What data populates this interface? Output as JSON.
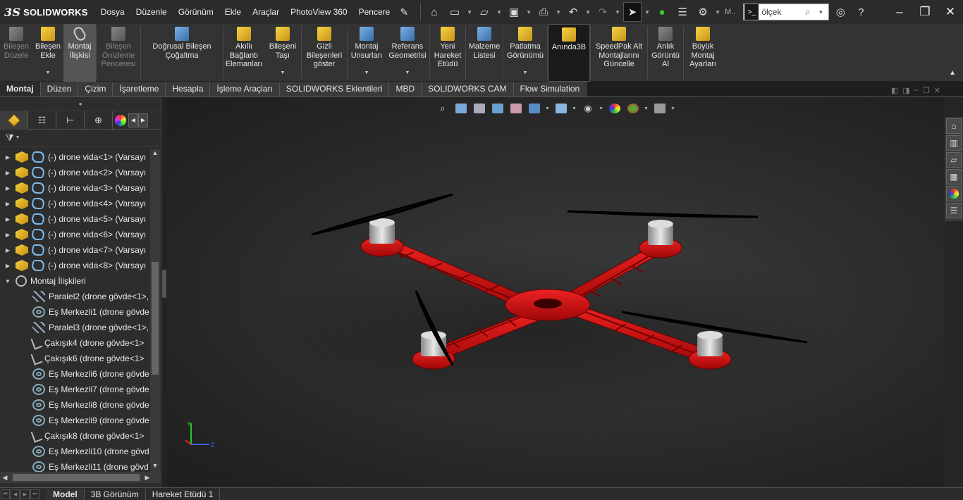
{
  "app": {
    "brand": "SOLIDWORKS"
  },
  "menus": [
    "Dosya",
    "Düzenle",
    "Görünüm",
    "Ekle",
    "Araçlar",
    "PhotoView 360",
    "Pencere"
  ],
  "search": {
    "value": "ölçek",
    "more_label": "M.."
  },
  "ribbon": [
    {
      "label": "Bileşen Düzele",
      "disabled": true,
      "icon": "edit-component-icon"
    },
    {
      "label": "Bileşen Ekle",
      "icon": "insert-component-icon"
    },
    {
      "label": "Montaj İlişkisi",
      "active": true,
      "icon": "mate-icon"
    },
    {
      "label": "Bileşen Önizleme Penceresi",
      "disabled": true,
      "icon": "component-preview-icon"
    },
    {
      "label": "Doğrusal Bileşen Çoğaltma",
      "icon": "linear-pattern-icon"
    },
    {
      "label": "Akıllı Bağlantı Elemanları",
      "icon": "smart-fasteners-icon"
    },
    {
      "label": "Bileşeni Taşı",
      "icon": "move-component-icon"
    },
    {
      "label": "Gizli Bileşenleri göster",
      "icon": "show-hidden-icon"
    },
    {
      "label": "Montaj Unsurları",
      "icon": "assembly-features-icon"
    },
    {
      "label": "Referans Geometrisi",
      "icon": "reference-geometry-icon"
    },
    {
      "label": "Yeni Hareket Etüdü",
      "icon": "new-motion-study-icon"
    },
    {
      "label": "Malzeme Listesi",
      "icon": "bom-icon"
    },
    {
      "label": "Patlatma Görünümü",
      "icon": "exploded-view-icon"
    },
    {
      "label": "Anında3B",
      "boxed": true,
      "icon": "instant3d-icon"
    },
    {
      "label": "SpeedPak Alt Montajlarını Güncelle",
      "icon": "speedpak-icon"
    },
    {
      "label": "Anlık Görüntü Al",
      "icon": "snapshot-icon"
    },
    {
      "label": "Büyük Montaj Ayarları",
      "icon": "large-assembly-icon"
    }
  ],
  "tabs": [
    "Montaj",
    "Düzen",
    "Çizim",
    "İşaretleme",
    "Hesapla",
    "İşleme Araçları",
    "SOLIDWORKS Eklentileri",
    "MBD",
    "SOLIDWORKS CAM",
    "Flow Simulation"
  ],
  "tree": {
    "components": [
      "(-) drone vida<1> (Varsayı",
      "(-) drone vida<2> (Varsayı",
      "(-) drone vida<3> (Varsayı",
      "(-) drone vida<4> (Varsayı",
      "(-) drone vida<5> (Varsayı",
      "(-) drone vida<6> (Varsayı",
      "(-) drone vida<7> (Varsayı",
      "(-) drone vida<8> (Varsayı"
    ],
    "mates_folder": "Montaj İlişkileri",
    "mates": [
      {
        "label": "Paralel2 (drone gövde<1>,",
        "type": "parallel"
      },
      {
        "label": "Eş Merkezli1 (drone gövde",
        "type": "concentric"
      },
      {
        "label": "Paralel3 (drone gövde<1>,",
        "type": "parallel"
      },
      {
        "label": "Çakışık4 (drone gövde<1>",
        "type": "coincident"
      },
      {
        "label": "Çakışık6 (drone gövde<1>",
        "type": "coincident"
      },
      {
        "label": "Eş Merkezli6 (drone gövde",
        "type": "concentric"
      },
      {
        "label": "Eş Merkezli7 (drone gövde",
        "type": "concentric"
      },
      {
        "label": "Eş Merkezli8 (drone gövde",
        "type": "concentric"
      },
      {
        "label": "Eş Merkezli9 (drone gövde",
        "type": "concentric"
      },
      {
        "label": "Çakışık8 (drone gövde<1>",
        "type": "coincident"
      },
      {
        "label": "Eş Merkezli10 (drone gövd",
        "type": "concentric"
      },
      {
        "label": "Eş Merkezli11 (drone gövd",
        "type": "concentric"
      }
    ]
  },
  "triad": {
    "y": "Y",
    "z": "Z"
  },
  "bottom_tabs": [
    "Model",
    "3B Görünüm",
    "Hareket Etüdü 1"
  ],
  "colors": {
    "frame": "#d01010",
    "background": "#2a2a2a",
    "accent": "#3a8ad8"
  }
}
